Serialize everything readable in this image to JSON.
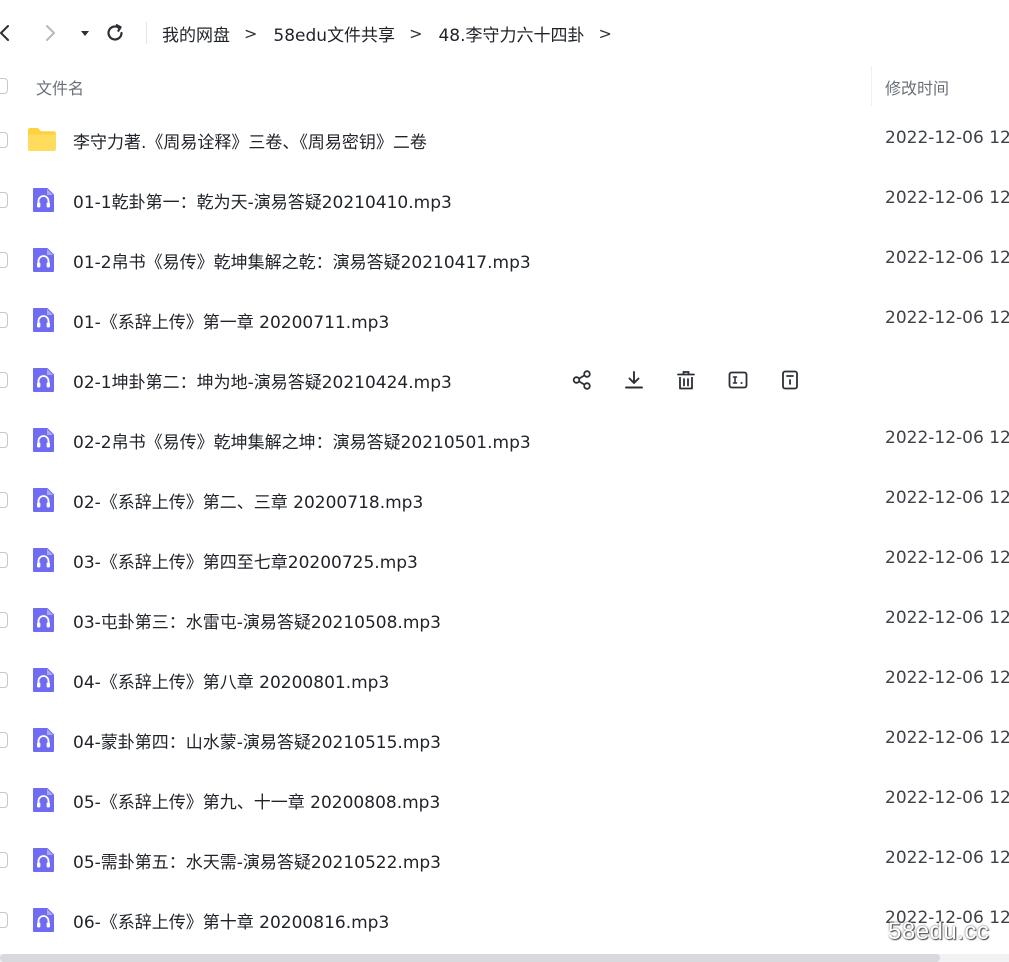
{
  "nav": {
    "breadcrumbs": [
      "我的网盘",
      "58edu文件共享",
      "48.李守力六十四卦"
    ],
    "separator": ">"
  },
  "columns": {
    "name": "文件名",
    "modified": "修改时间"
  },
  "files": [
    {
      "type": "folder",
      "name": "李守力著.《周易诠释》三卷、《周易密钥》二卷",
      "time": "2022-12-06 12"
    },
    {
      "type": "audio",
      "name": "01-1乾卦第一：乾为天-演易答疑20210410.mp3",
      "time": "2022-12-06 12"
    },
    {
      "type": "audio",
      "name": "01-2帛书《易传》乾坤集解之乾：演易答疑20210417.mp3",
      "time": "2022-12-06 12"
    },
    {
      "type": "audio",
      "name": "01-《系辞上传》第一章 20200711.mp3",
      "time": "2022-12-06 12"
    },
    {
      "type": "audio",
      "name": "02-1坤卦第二：坤为地-演易答疑20210424.mp3",
      "time": "",
      "hovered": true
    },
    {
      "type": "audio",
      "name": "02-2帛书《易传》乾坤集解之坤：演易答疑20210501.mp3",
      "time": "2022-12-06 12"
    },
    {
      "type": "audio",
      "name": "02-《系辞上传》第二、三章 20200718.mp3",
      "time": "2022-12-06 12"
    },
    {
      "type": "audio",
      "name": "03-《系辞上传》第四至七章20200725.mp3",
      "time": "2022-12-06 12"
    },
    {
      "type": "audio",
      "name": "03-屯卦第三：水雷屯-演易答疑20210508.mp3",
      "time": "2022-12-06 12"
    },
    {
      "type": "audio",
      "name": "04-《系辞上传》第八章 20200801.mp3",
      "time": "2022-12-06 12"
    },
    {
      "type": "audio",
      "name": "04-蒙卦第四：山水蒙-演易答疑20210515.mp3",
      "time": "2022-12-06 12"
    },
    {
      "type": "audio",
      "name": "05-《系辞上传》第九、十一章 20200808.mp3",
      "time": "2022-12-06 12"
    },
    {
      "type": "audio",
      "name": "05-需卦第五：水天需-演易答疑20210522.mp3",
      "time": "2022-12-06 12"
    },
    {
      "type": "audio",
      "name": "06-《系辞上传》第十章 20200816.mp3",
      "time": "2022-12-06 12"
    }
  ],
  "row_actions": [
    "share-icon",
    "download-icon",
    "delete-icon",
    "rename-icon",
    "more-icon"
  ],
  "colors": {
    "folder": "#fdd23f",
    "audio": "#6f6bf2",
    "text": "#1f2329",
    "muted": "#6b7078"
  },
  "watermark": "58edu.cc"
}
